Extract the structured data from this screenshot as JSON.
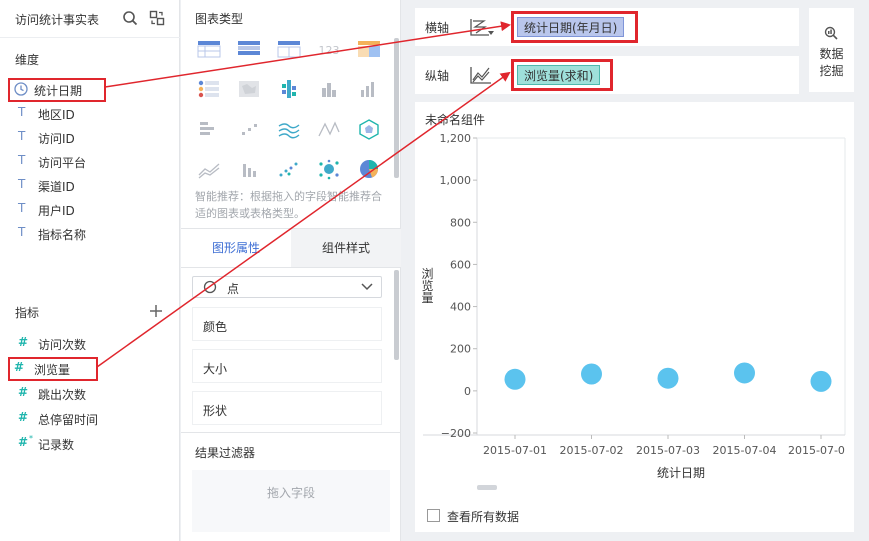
{
  "dataset": {
    "title": "访问统计事实表",
    "icons": [
      "search-icon",
      "switch-dataset-icon"
    ]
  },
  "dimension_section": {
    "title": "维度"
  },
  "dimensions": [
    {
      "label": "统计日期",
      "type": "date",
      "highlighted": true
    },
    {
      "label": "地区ID",
      "type": "text"
    },
    {
      "label": "访问ID",
      "type": "text"
    },
    {
      "label": "访问平台",
      "type": "text"
    },
    {
      "label": "渠道ID",
      "type": "text"
    },
    {
      "label": "用户ID",
      "type": "text"
    },
    {
      "label": "指标名称",
      "type": "text"
    }
  ],
  "measure_section": {
    "title": "指标",
    "add_icon": "plus-icon"
  },
  "measures": [
    {
      "label": "访问次数",
      "type": "number"
    },
    {
      "label": "浏览量",
      "type": "number",
      "highlighted": true
    },
    {
      "label": "跳出次数",
      "type": "number"
    },
    {
      "label": "总停留时间",
      "type": "number"
    },
    {
      "label": "记录数",
      "type": "count"
    }
  ],
  "chart_types": {
    "title": "图表类型",
    "rows": 4,
    "cols": 5
  },
  "smart_hint": "智能推荐：根据拖入的字段智能推荐合适的图表或表格类型。",
  "tabs": [
    {
      "label": "图形属性",
      "active": true
    },
    {
      "label": "组件样式",
      "active": false
    }
  ],
  "shape_select": {
    "value": "点"
  },
  "properties": [
    "颜色",
    "大小",
    "形状"
  ],
  "result_filter": {
    "title": "结果过滤器",
    "placeholder": "拖入字段"
  },
  "x_axis": {
    "label": "横轴",
    "pill": "统计日期(年月日)",
    "pill_bg": "#b9c6ec",
    "pill_border": "#7f95d8"
  },
  "y_axis": {
    "label": "纵轴",
    "pill": "浏览量(求和)",
    "pill_bg": "#9fe0da",
    "pill_border": "#4fb8ad"
  },
  "data_mining": {
    "line1": "数据",
    "line2": "挖掘"
  },
  "widget": {
    "title": "未命名组件"
  },
  "show_all_data": {
    "label": "查看所有数据",
    "checked": false
  },
  "colors": {
    "accent": "#3f6fd4",
    "highlight": "#e0262d",
    "point": "#5bc3ee"
  },
  "chart_data": {
    "type": "scatter",
    "categories": [
      "2015-07-01",
      "2015-07-02",
      "2015-07-03",
      "2015-07-04",
      "2015-07-0"
    ],
    "values": [
      55,
      80,
      60,
      85,
      45
    ],
    "xlabel": "统计日期",
    "ylabel": "浏览量",
    "ylim": [
      -200,
      1200
    ],
    "yticks": [
      1200,
      1000,
      800,
      600,
      400,
      200,
      0,
      -200
    ],
    "ytick_labels": [
      "1,200",
      "1,000",
      "800",
      "600",
      "400",
      "200",
      "0",
      "−200"
    ],
    "grid": false
  }
}
